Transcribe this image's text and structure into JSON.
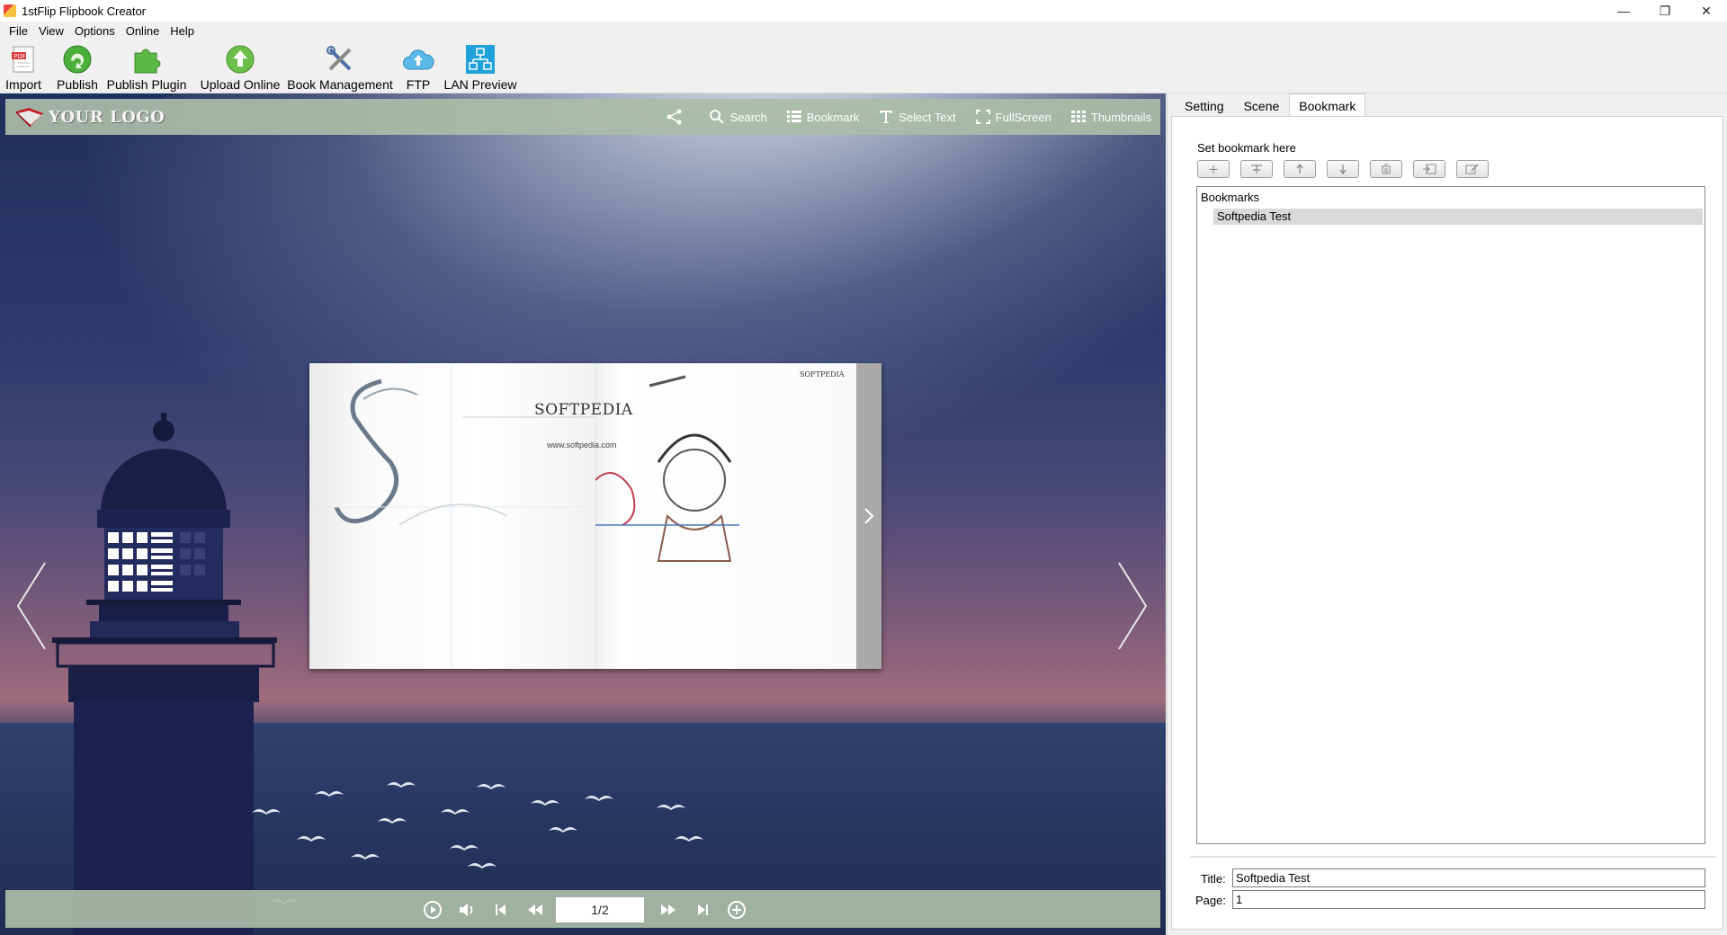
{
  "window": {
    "title": "1stFlip Flipbook Creator",
    "controls": [
      "—",
      "❐",
      "✕"
    ]
  },
  "menu": [
    "File",
    "View",
    "Options",
    "Online",
    "Help"
  ],
  "toolbar": {
    "import": "Import",
    "publish": "Publish",
    "publish_plugin": "Publish Plugin",
    "upload_online": "Upload Online",
    "book_management": "Book Management",
    "ftp": "FTP",
    "lan_preview": "LAN Preview"
  },
  "viewer": {
    "logo": "YOUR LOGO",
    "tools": {
      "search": "Search",
      "bookmark": "Bookmark",
      "select_text": "Select Text",
      "fullscreen": "FullScreen",
      "thumbnails": "Thumbnails"
    },
    "page_content": {
      "brand": "SOFTPEDIA",
      "url": "www.softpedia.com",
      "brand_small": "SOFTPEDIA"
    },
    "page_indicator": "1/2"
  },
  "side_panel": {
    "tabs": [
      "Setting",
      "Scene",
      "Bookmark"
    ],
    "active_tab": "Bookmark",
    "set_label": "Set bookmark here",
    "tree_root": "Bookmarks",
    "bookmarks": [
      "Softpedia Test"
    ],
    "title_label": "Title:",
    "title_value": "Softpedia Test",
    "page_label": "Page:",
    "page_value": "1"
  }
}
